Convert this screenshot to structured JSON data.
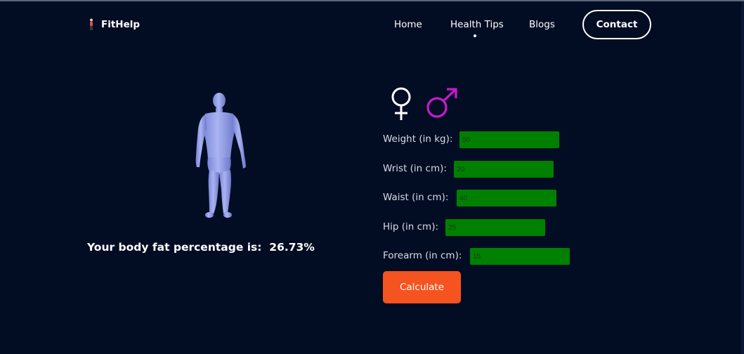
{
  "brand": {
    "name": "FitHelp",
    "logo_icon": "person-logo-icon"
  },
  "nav": {
    "items": [
      {
        "label": "Home"
      },
      {
        "label": "Health Tips",
        "active": true
      },
      {
        "label": "Blogs"
      }
    ],
    "contact_label": "Contact"
  },
  "figure": {
    "icon": "human-body-3d-model"
  },
  "result": {
    "label": "Your body fat percentage is:",
    "value": "26.73%"
  },
  "gender": {
    "female_icon": "female-symbol-icon",
    "male_icon": "male-symbol-icon",
    "female_color": "#ffffff",
    "male_color": "#c51bc9"
  },
  "form": {
    "fields": [
      {
        "label": "Weight (in kg):",
        "value": "50"
      },
      {
        "label": "Wrist (in cm):",
        "value": "20"
      },
      {
        "label": "Waist (in cm):",
        "value": "40"
      },
      {
        "label": "Hip (in cm):",
        "value": "25"
      },
      {
        "label": "Forearm (in cm):",
        "value": "15"
      }
    ],
    "submit_label": "Calculate"
  },
  "colors": {
    "background": "#020d24",
    "input_bg": "#008000",
    "accent": "#f5531f"
  }
}
